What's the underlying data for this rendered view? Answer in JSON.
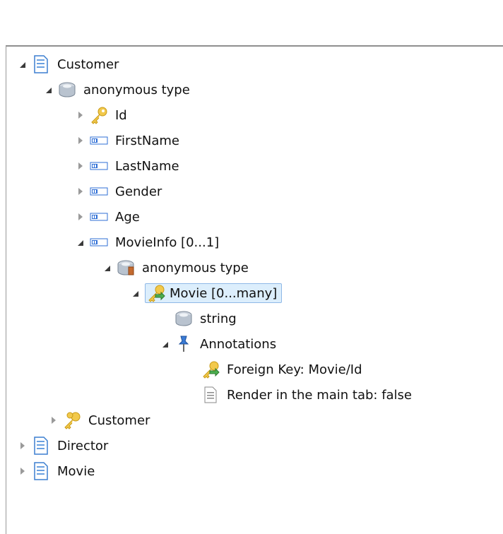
{
  "tree": {
    "rows": [
      {
        "label": "Customer",
        "icon": "document-icon",
        "state": "expanded"
      },
      {
        "label": "anonymous type",
        "icon": "complex-type-icon",
        "state": "expanded"
      },
      {
        "label": "Id",
        "icon": "key-icon",
        "state": "collapsed"
      },
      {
        "label": "FirstName",
        "icon": "field-icon",
        "state": "collapsed"
      },
      {
        "label": "LastName",
        "icon": "field-icon",
        "state": "collapsed"
      },
      {
        "label": "Gender",
        "icon": "field-icon",
        "state": "collapsed"
      },
      {
        "label": "Age",
        "icon": "field-icon",
        "state": "collapsed"
      },
      {
        "label": "MovieInfo  [0...1]",
        "icon": "field-icon",
        "state": "expanded"
      },
      {
        "label": "anonymous type",
        "icon": "complex-type-icon",
        "state": "expanded"
      },
      {
        "label": "Movie  [0...many]",
        "icon": "foreign-key-icon",
        "state": "expanded",
        "selected": true
      },
      {
        "label": "string",
        "icon": "simple-type-icon",
        "state": "leaf"
      },
      {
        "label": "Annotations",
        "icon": "pin-icon",
        "state": "expanded"
      },
      {
        "label": "Foreign Key:  Movie/Id",
        "icon": "foreign-key-icon",
        "state": "leaf"
      },
      {
        "label": "Render in the main tab: false",
        "icon": "note-icon",
        "state": "leaf"
      },
      {
        "label": "Customer",
        "icon": "keys-icon",
        "state": "collapsed"
      },
      {
        "label": "Director",
        "icon": "document-icon",
        "state": "collapsed"
      },
      {
        "label": "Movie",
        "icon": "document-icon",
        "state": "collapsed"
      }
    ]
  }
}
